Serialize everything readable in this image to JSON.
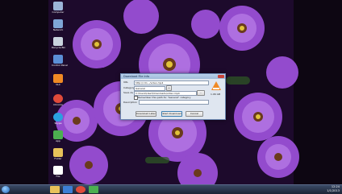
{
  "desktop": {
    "icons": [
      {
        "label": "Computer",
        "color": "#9bb4d8"
      },
      {
        "label": "Network",
        "color": "#7fa6d6"
      },
      {
        "label": "Recycle Bin",
        "color": "#c9d3de"
      },
      {
        "label": "Control Panel",
        "color": "#5b8fd6"
      },
      {
        "label": "VLC",
        "color": "#f08a24"
      },
      {
        "label": "Chrome",
        "color": "#e04b3a"
      },
      {
        "label": "Skype",
        "color": "#2aa0e0"
      },
      {
        "label": "App",
        "color": "#4caf50"
      },
      {
        "label": "Folder",
        "color": "#e8c25a"
      },
      {
        "label": "File",
        "color": "#ffffff"
      }
    ]
  },
  "dialog": {
    "title": "Download File Info",
    "url": "http://cdn.../video.mp4",
    "category_label": "Category",
    "category_value": "General",
    "save_as_label": "Save As",
    "save_as_value": "C:\\Users\\User\\Downloads\\video.mp4",
    "remember_label": "Remember this path for \"General\" category",
    "description_label": "Description",
    "file_size": "1.06 GB",
    "buttons": {
      "download_later": "Download Later",
      "start_download": "Start Download",
      "cancel": "Cancel"
    }
  },
  "taskbar": {
    "time": "12:24",
    "date": "1/1/2013",
    "items": [
      {
        "name": "explorer",
        "color": "#e8c25a"
      },
      {
        "name": "media",
        "color": "#3d7fd6"
      },
      {
        "name": "chrome",
        "color": "#e04b3a"
      },
      {
        "name": "idm",
        "color": "#4caf50"
      }
    ]
  }
}
